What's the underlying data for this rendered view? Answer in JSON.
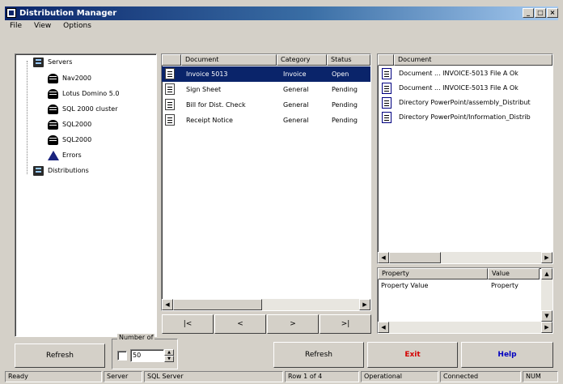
{
  "window": {
    "title": "Distribution Manager",
    "controls": [
      "_",
      "□",
      "×"
    ]
  },
  "menu": [
    "File",
    "View",
    "Options"
  ],
  "tree": {
    "items": [
      {
        "label": "Servers",
        "icon": "server-icon"
      },
      {
        "label": "Nav2000",
        "icon": "database-icon"
      },
      {
        "label": "Lotus Domino 5.0",
        "icon": "database-icon"
      },
      {
        "label": "SQL 2000 cluster",
        "icon": "database-icon"
      },
      {
        "label": "SQL2000",
        "icon": "database-icon"
      },
      {
        "label": "SQL2000",
        "icon": "database-icon"
      },
      {
        "label": "Errors",
        "icon": "warning-icon"
      },
      {
        "label": "Distributions",
        "icon": "server-icon"
      }
    ]
  },
  "middle_list": {
    "columns": [
      "",
      "Document",
      "Category",
      "Status"
    ],
    "rows": [
      {
        "name": "Invoice 5013",
        "category": "Invoice",
        "status": "Open"
      },
      {
        "name": "Sign Sheet",
        "category": "General",
        "status": "Pending"
      },
      {
        "name": "Bill for Dist. Check",
        "category": "General",
        "status": "Pending"
      },
      {
        "name": "Receipt Notice",
        "category": "General",
        "status": "Pending"
      }
    ],
    "nav_buttons": [
      "|<",
      "<",
      ">",
      ">|"
    ]
  },
  "right_list": {
    "column": "Document",
    "rows": [
      "Document ... INVOICE-5013 File A Ok",
      "Document ... INVOICE-5013 File A Ok",
      "Directory PowerPoint/assembly_Distribut",
      "Directory PowerPoint/Information_Distrib"
    ]
  },
  "props": {
    "columns": [
      "Property",
      "Value"
    ],
    "rows": [
      {
        "name": "Property Value",
        "value": "Property"
      }
    ]
  },
  "bottom": {
    "refresh_label": "Refresh",
    "group_label": "Number of",
    "checkbox_value": "50",
    "button_mid": "Refresh",
    "button_red": "Exit",
    "button_blue": "Help"
  },
  "status": [
    "Ready",
    "Server",
    "SQL Server",
    "Row 1 of 4",
    "Operational",
    "Connected",
    "NUM"
  ],
  "colors": {
    "selection": "#0a246a",
    "red_label": "#d40000",
    "blue_label": "#0000c0"
  }
}
